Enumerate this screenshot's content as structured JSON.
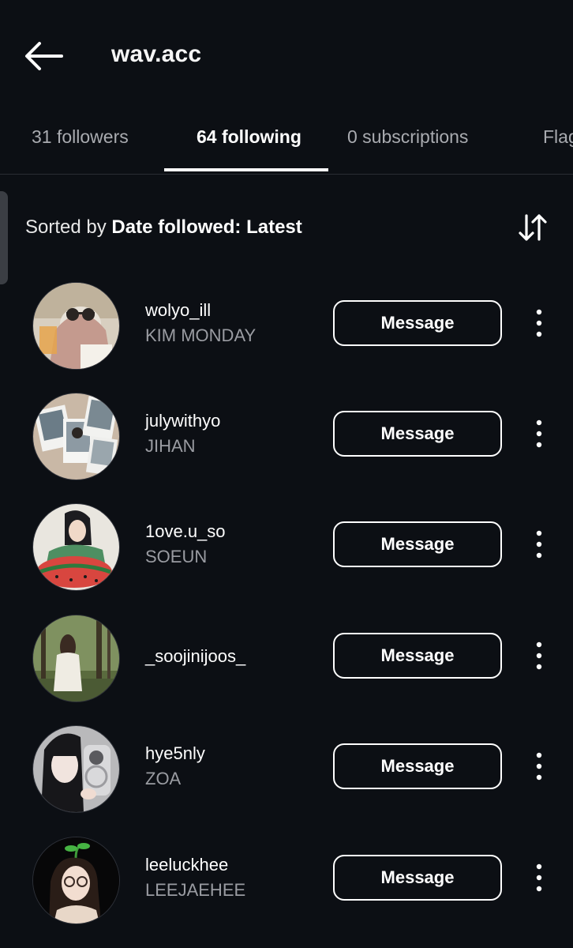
{
  "header": {
    "title": "wav.acc"
  },
  "tabs": [
    {
      "label": "31 followers"
    },
    {
      "label": "64 following"
    },
    {
      "label": "0 subscriptions"
    },
    {
      "label": "Flag"
    }
  ],
  "sort": {
    "prefix": "Sorted by ",
    "value": "Date followed: Latest"
  },
  "accounts": [
    {
      "username": "wolyo_ill",
      "name": "KIM MONDAY",
      "button": "Message"
    },
    {
      "username": "julywithyo",
      "name": "JIHAN",
      "button": "Message"
    },
    {
      "username": "1ove.u_so",
      "name": "SOEUN",
      "button": "Message"
    },
    {
      "username": "_soojinijoos_",
      "name": "",
      "button": "Message"
    },
    {
      "username": "hye5nly",
      "name": "ZOA",
      "button": "Message"
    },
    {
      "username": "leeluckhee",
      "name": "LEEJAEHEE",
      "button": "Message"
    }
  ]
}
